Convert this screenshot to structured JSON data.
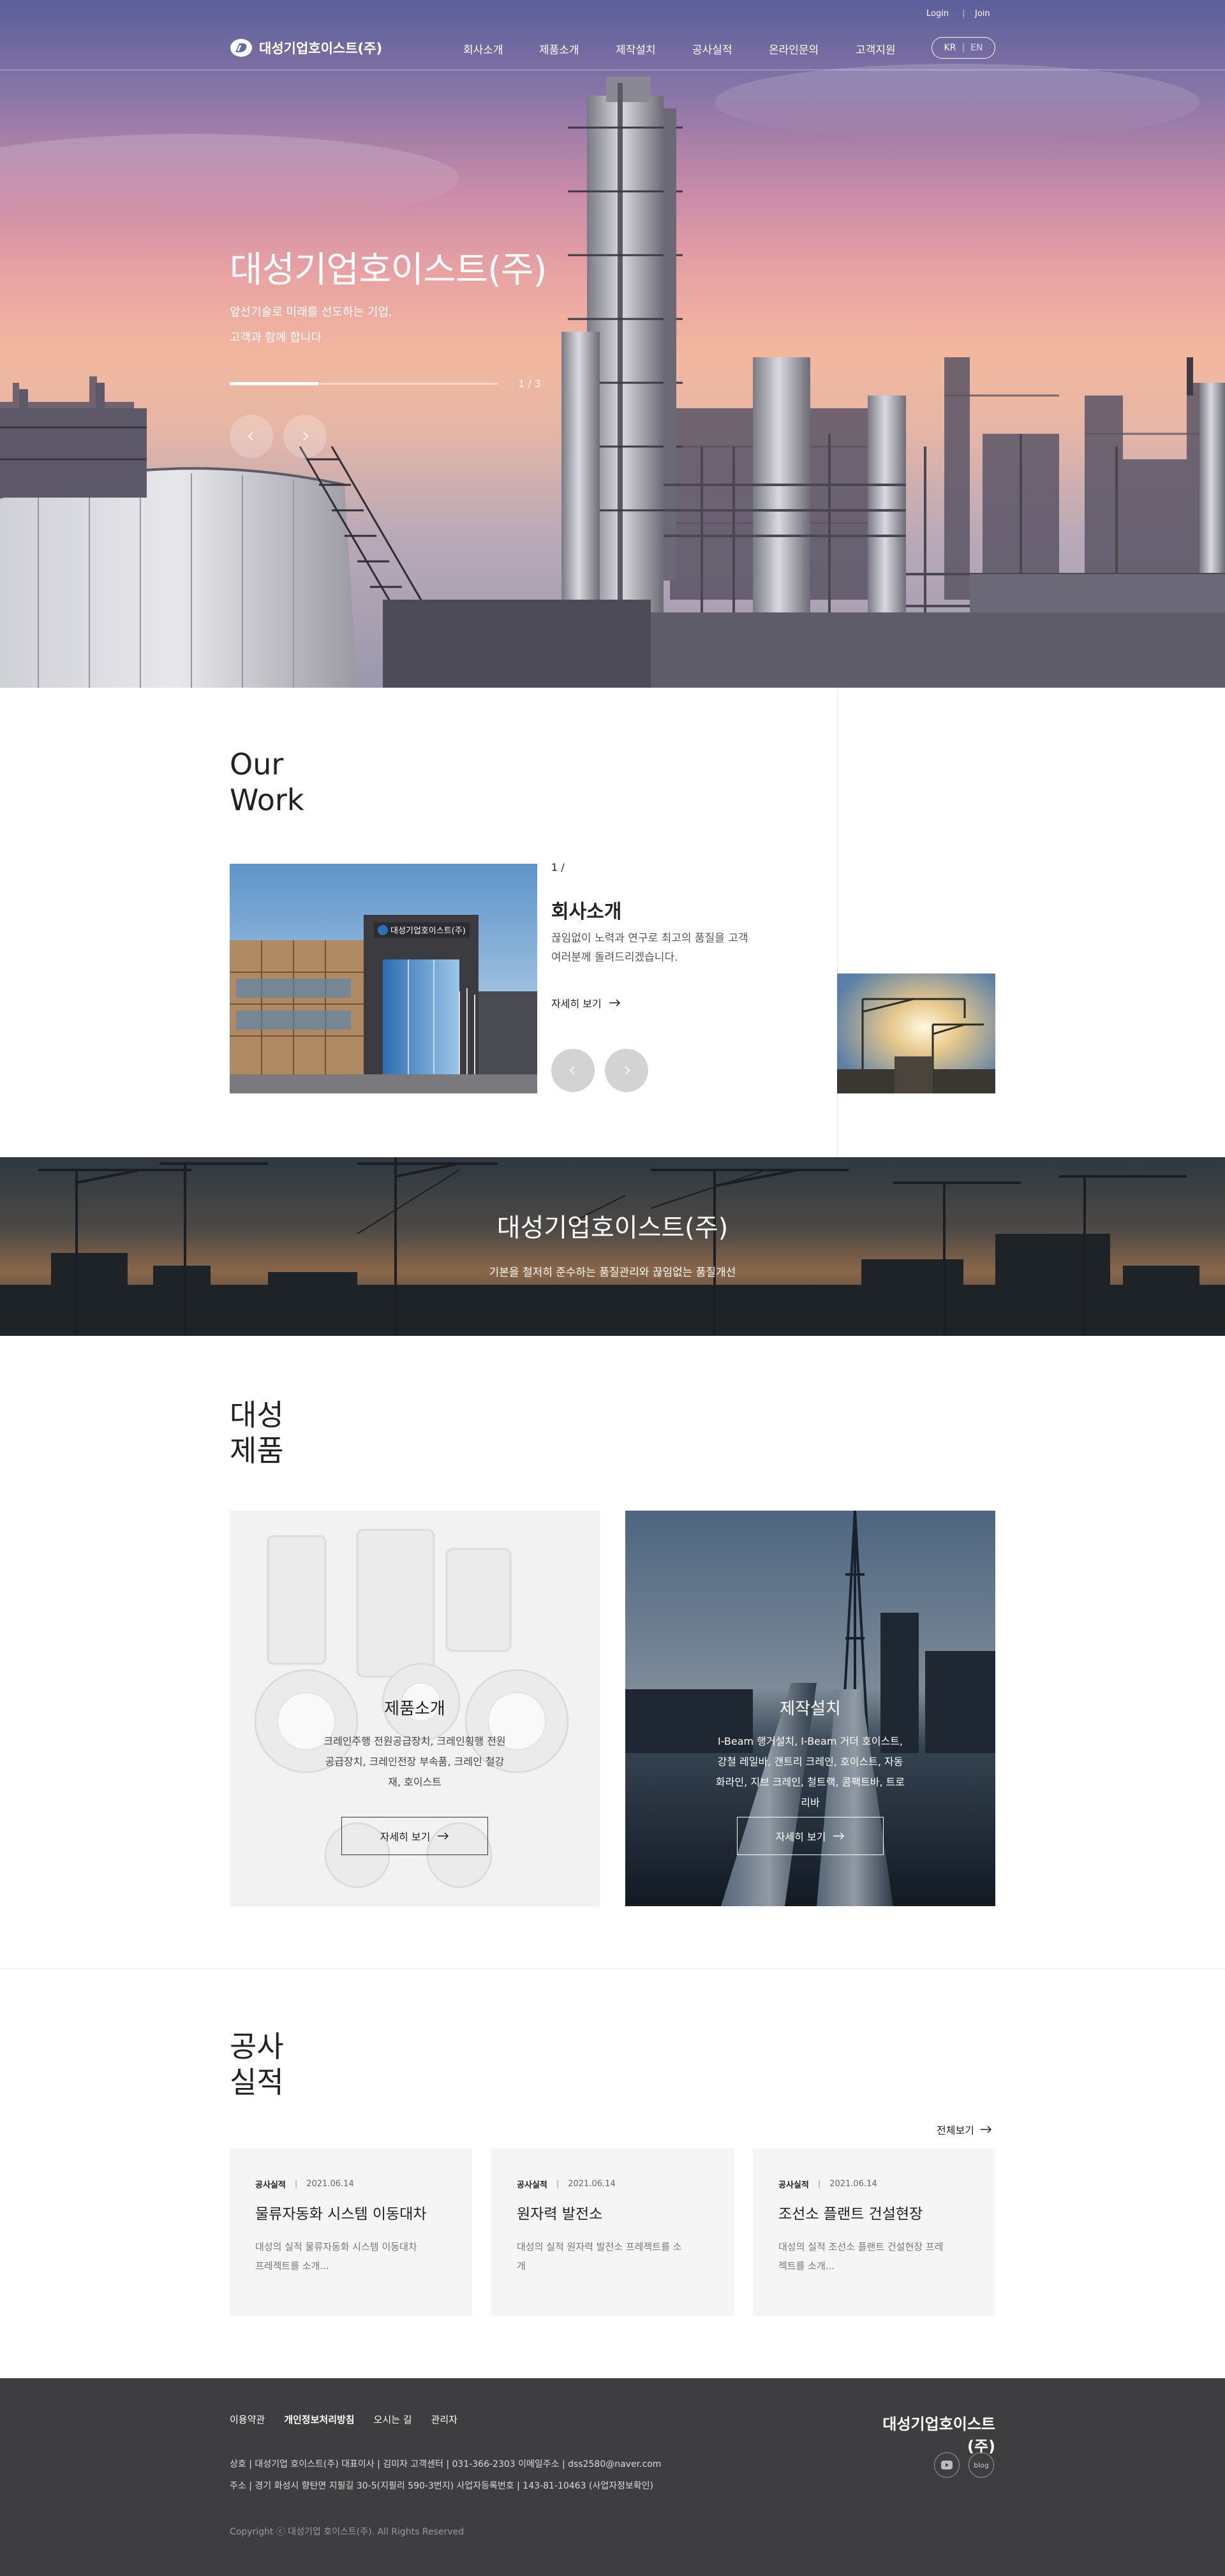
{
  "header": {
    "login": "Login",
    "join": "Join",
    "logo_text": "대성기업호이스트(주)",
    "nav": [
      "회사소개",
      "제품소개",
      "제작설치",
      "공사실적",
      "온라인문의",
      "고객지원"
    ],
    "lang_kr": "KR",
    "lang_sep": "|",
    "lang_en": "EN"
  },
  "hero": {
    "title": "대성기업호이스트(주)",
    "subtitle_line1": "앞선기술로 미래를 선도하는 기업,",
    "subtitle_line2": "고객과 함께 합니다",
    "page": "1 / 3",
    "progress": 0.33
  },
  "our_work": {
    "title_line1": "Our",
    "title_line2": "Work",
    "page_current": "1 /",
    "page_total": "",
    "heading": "회사소개",
    "desc_line1": "끊임없이 노력과 연구로 최고의 품질을 고객",
    "desc_line2": "여러분께 돌려드리겠습니다.",
    "more": "자세히 보기",
    "building_sign": "대성기업호이스트(주)"
  },
  "banner": {
    "title": "대성기업호이스트(주)",
    "subtitle": "기본을 철저히 준수하는 품질관리와 끊임없는 품질개선"
  },
  "products": {
    "title_line1": "대성",
    "title_line2": "제품",
    "cards": [
      {
        "title": "제품소개",
        "desc": "크레인주행 전원공급장치, 크레인횡행 전원공급장치, 크레인전장 부속품, 크레인 철강재, 호이스트",
        "button": "자세히 보기"
      },
      {
        "title": "제작설치",
        "desc": "I-Beam 행거설치, I-Beam 거더 호이스트, 강철 레일바, 갠트리 크레인, 호이스트, 자동화라인, 지브 크레인, 철트랙, 콤팩트바, 트로리바",
        "button": "자세히 보기"
      }
    ]
  },
  "performance": {
    "title_line1": "공사",
    "title_line2": "실적",
    "view_all": "전체보기",
    "items": [
      {
        "category": "공사실적",
        "date": "2021.06.14",
        "title": "물류자동화 시스템 이동대차",
        "desc": "대성의 실적 물류자동화 시스템 이동대차 프레젝트를 소개..."
      },
      {
        "category": "공사실적",
        "date": "2021.06.14",
        "title": "원자력 발전소",
        "desc": "대성의 실적 원자력 발전소 프레젝트를 소개"
      },
      {
        "category": "공사실적",
        "date": "2021.06.14",
        "title": "조선소 플랜트 건설현장",
        "desc": "대성의 실적 조선소 플랜트 건설현장 프레젝트를 소개..."
      }
    ]
  },
  "footer": {
    "links": [
      "이용약관",
      "개인정보처리방침",
      "오시는 길",
      "관리자"
    ],
    "logo_text": "대성기업호이스트(주)",
    "info_line1": "상호 | 대성기업 호이스트(주)   대표이사 | 김미자   고객센터 | 031-366-2303   이메일주소 | dss2580@naver.com",
    "info_line2": "주소 | 경기 화성시 향탄면 지필길 30-5(지필리 590-3번지)   사업자등록번호 | 143-81-10463 (사업자정보확인)",
    "copyright": "Copyright ⓒ 대성기업 호이스트(주). All Rights Reserved",
    "social": [
      "youtube-icon",
      "blog-icon"
    ],
    "blog_label": "blog"
  },
  "colors": {
    "footer_bg": "#3e3e40",
    "card_light_bg": "#ececec",
    "card_dark_bg": "#2a3645",
    "perf_card_bg": "#f5f5f5"
  }
}
